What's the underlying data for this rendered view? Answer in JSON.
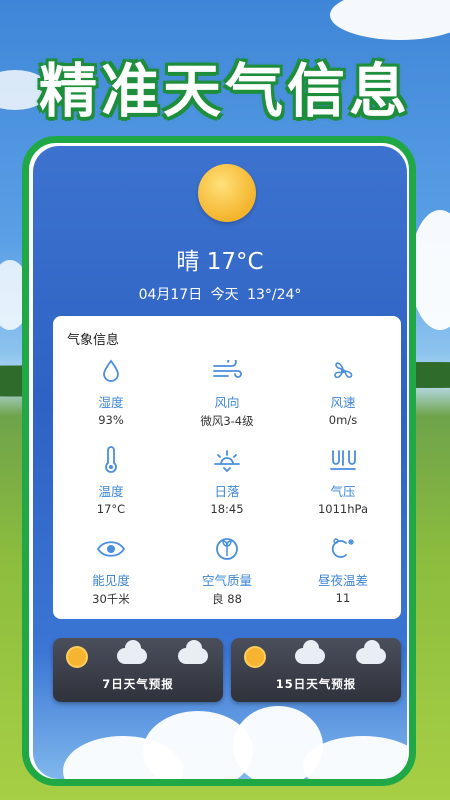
{
  "banner": {
    "title": "精准天气信息"
  },
  "weather": {
    "condition": "晴 17°C",
    "date_line": "04月17日 今天 13°/24°"
  },
  "info_card": {
    "title": "气象信息",
    "items": [
      {
        "icon": "humidity-icon",
        "label": "湿度",
        "value": "93%"
      },
      {
        "icon": "wind-direction-icon",
        "label": "风向",
        "value": "微风3-4级"
      },
      {
        "icon": "wind-speed-icon",
        "label": "风速",
        "value": "0m/s"
      },
      {
        "icon": "thermometer-icon",
        "label": "温度",
        "value": "17°C"
      },
      {
        "icon": "sunset-icon",
        "label": "日落",
        "value": "18:45"
      },
      {
        "icon": "pressure-icon",
        "label": "气压",
        "value": "1011hPa"
      },
      {
        "icon": "eye-icon",
        "label": "能见度",
        "value": "30千米"
      },
      {
        "icon": "leaf-icon",
        "label": "空气质量",
        "value": "良 88"
      },
      {
        "icon": "temperature-difference-icon",
        "label": "昼夜温差",
        "value": "11"
      }
    ]
  },
  "forecast": {
    "seven_day": "7日天气预报",
    "fifteen_day": "15日天气预报"
  },
  "colors": {
    "frame_green": "#1fa845",
    "accent_blue": "#3e86d6"
  }
}
